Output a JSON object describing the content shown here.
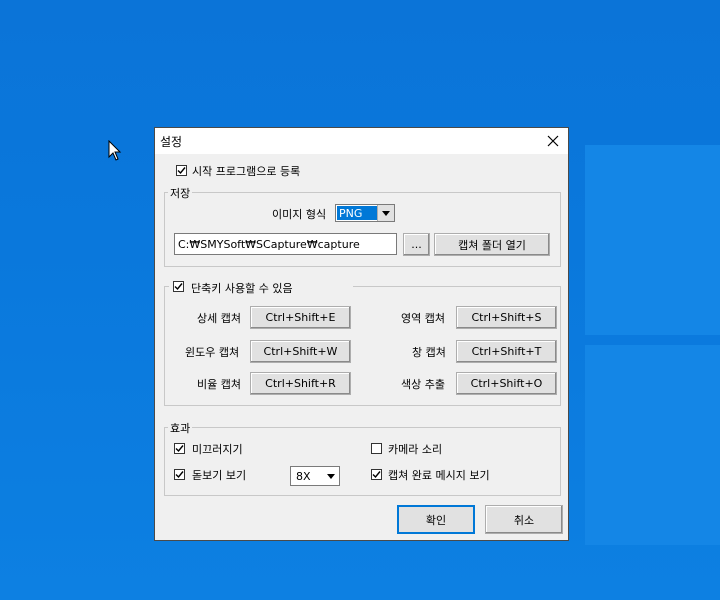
{
  "dialog": {
    "title": "설정",
    "startup_label": "시작 프로그램으로 등록",
    "startup_checked": true
  },
  "save": {
    "group_label": "저장",
    "format_label": "이미지 형식",
    "format_value": "PNG",
    "path_value": "C:₩SMYSoft₩SCapture₩capture",
    "browse_label": "...",
    "open_folder_label": "캡쳐 폴더 열기"
  },
  "shortcuts": {
    "enable_label": "단축키 사용할 수 있음",
    "enable_checked": true,
    "items": [
      {
        "label": "상세 캡쳐",
        "key": "Ctrl+Shift+E"
      },
      {
        "label": "영역 캡쳐",
        "key": "Ctrl+Shift+S"
      },
      {
        "label": "윈도우 캡쳐",
        "key": "Ctrl+Shift+W"
      },
      {
        "label": "창 캡쳐",
        "key": "Ctrl+Shift+T"
      },
      {
        "label": "비율 캡쳐",
        "key": "Ctrl+Shift+R"
      },
      {
        "label": "색상 추출",
        "key": "Ctrl+Shift+O"
      }
    ]
  },
  "effects": {
    "group_label": "효과",
    "smooth_label": "미끄러지기",
    "smooth_checked": true,
    "camera_sound_label": "카메라 소리",
    "camera_sound_checked": false,
    "magnifier_label": "돋보기 보기",
    "magnifier_checked": true,
    "magnifier_zoom": "8X",
    "done_message_label": "캡쳐 완료 메시지 보기",
    "done_message_checked": true
  },
  "footer": {
    "ok_label": "확인",
    "cancel_label": "취소"
  },
  "colors": {
    "desktop": "#0a78dc",
    "selection": "#0078d7"
  }
}
